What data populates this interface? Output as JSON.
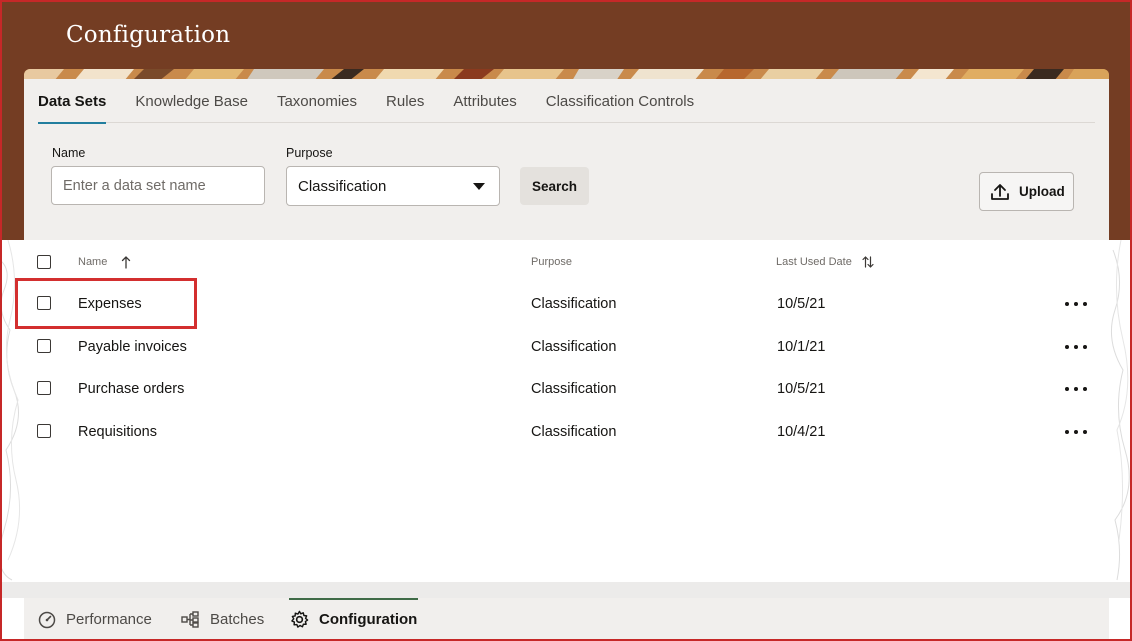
{
  "header": {
    "title": "Configuration"
  },
  "tabs": [
    {
      "label": "Data Sets",
      "active": true
    },
    {
      "label": "Knowledge Base",
      "active": false
    },
    {
      "label": "Taxonomies",
      "active": false
    },
    {
      "label": "Rules",
      "active": false
    },
    {
      "label": "Attributes",
      "active": false
    },
    {
      "label": "Classification Controls",
      "active": false
    }
  ],
  "filters": {
    "name_label": "Name",
    "name_placeholder": "Enter a data set name",
    "purpose_label": "Purpose",
    "purpose_value": "Classification",
    "search_label": "Search",
    "upload_label": "Upload"
  },
  "table": {
    "columns": {
      "name": "Name",
      "purpose": "Purpose",
      "last_used": "Last Used Date"
    },
    "rows": [
      {
        "name": "Expenses",
        "purpose": "Classification",
        "last_used": "10/5/21"
      },
      {
        "name": "Payable invoices",
        "purpose": "Classification",
        "last_used": "10/1/21"
      },
      {
        "name": "Purchase orders",
        "purpose": "Classification",
        "last_used": "10/5/21"
      },
      {
        "name": "Requisitions",
        "purpose": "Classification",
        "last_used": "10/4/21"
      }
    ]
  },
  "bottom_nav": [
    {
      "label": "Performance",
      "icon": "gauge-icon",
      "active": false
    },
    {
      "label": "Batches",
      "icon": "hierarchy-icon",
      "active": false
    },
    {
      "label": "Configuration",
      "icon": "gear-icon",
      "active": true
    }
  ],
  "colors": {
    "header_bg": "#743d23",
    "tab_indicator": "#227e9e",
    "highlight_box": "#d32f2f",
    "nav_indicator": "#3f6b47"
  }
}
